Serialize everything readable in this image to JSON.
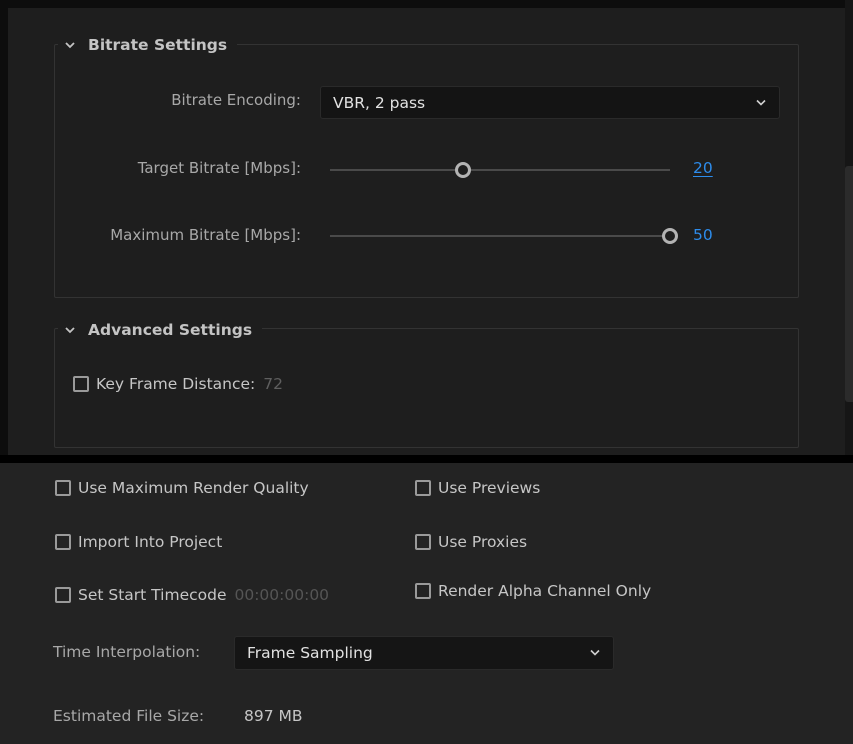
{
  "bitrate_settings": {
    "title": "Bitrate Settings",
    "encoding": {
      "label": "Bitrate Encoding:",
      "value": "VBR, 2 pass"
    },
    "target": {
      "label": "Target Bitrate [Mbps]:",
      "value": "20",
      "fraction": 0.39
    },
    "maximum": {
      "label": "Maximum Bitrate [Mbps]:",
      "value": "50",
      "fraction": 1.0
    }
  },
  "advanced_settings": {
    "title": "Advanced Settings",
    "key_frame": {
      "label": "Key Frame Distance:",
      "value": "72",
      "checked": false
    }
  },
  "options": {
    "use_max_render_quality": {
      "label": "Use Maximum Render Quality",
      "checked": false
    },
    "use_previews": {
      "label": "Use Previews",
      "checked": false
    },
    "import_into_project": {
      "label": "Import Into Project",
      "checked": false
    },
    "use_proxies": {
      "label": "Use Proxies",
      "checked": false
    },
    "set_start_timecode": {
      "label": "Set Start Timecode",
      "value": "00:00:00:00",
      "checked": false
    },
    "render_alpha_only": {
      "label": "Render Alpha Channel Only",
      "checked": false
    }
  },
  "time_interpolation": {
    "label": "Time Interpolation:",
    "value": "Frame Sampling"
  },
  "estimated_file_size": {
    "label": "Estimated File Size:",
    "value": "897 MB"
  },
  "colors": {
    "accent": "#2d8ceb",
    "panel": "#1e1e1e",
    "lower_panel": "#232323"
  },
  "icons": {
    "collapse": "chevron-down-icon",
    "dropdown": "dropdown-arrow-icon",
    "checkbox": "checkbox-icon"
  }
}
